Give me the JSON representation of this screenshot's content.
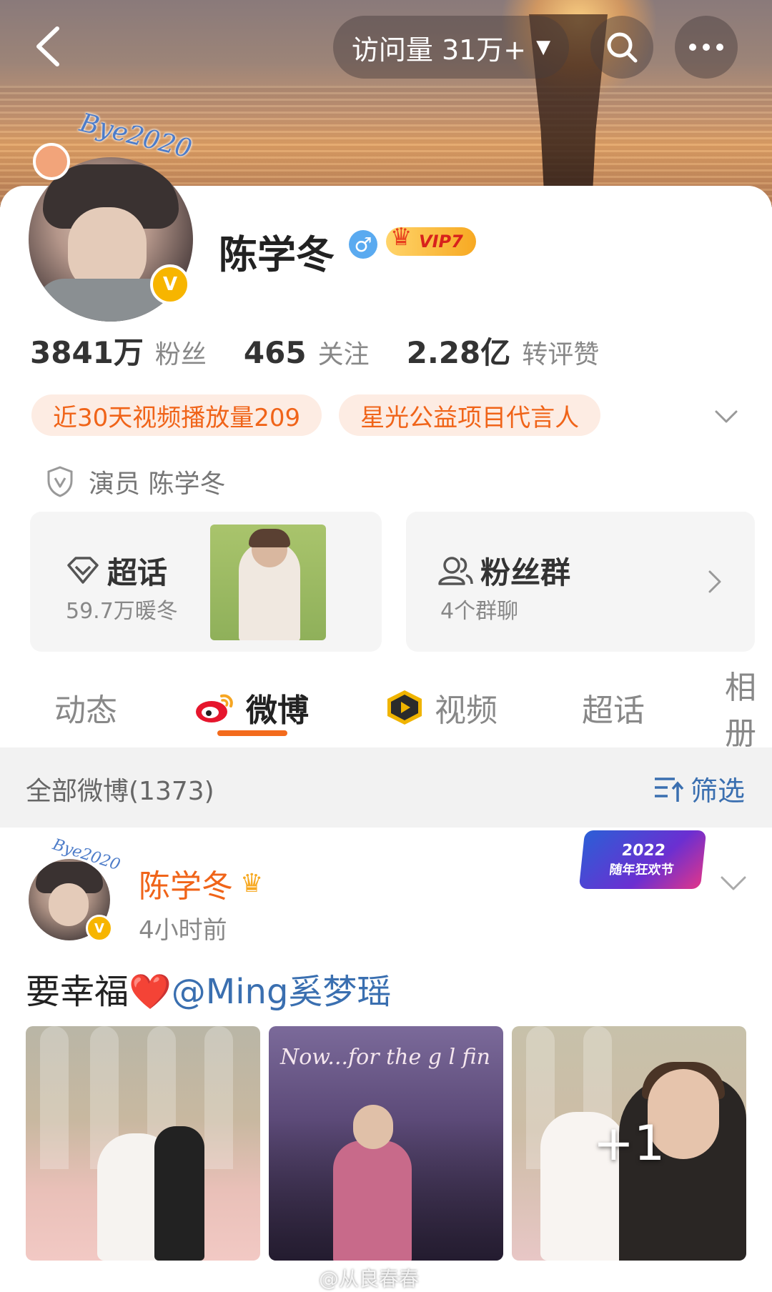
{
  "header": {
    "visit_label": "访问量 31万+"
  },
  "profile": {
    "name": "陈学冬",
    "avatar_frame_text": "Bye2020",
    "vip_label": "VIP7",
    "verified_badge": "V",
    "gender_symbol": "♂",
    "stats": [
      {
        "value": "3841万",
        "label": "粉丝"
      },
      {
        "value": "465",
        "label": "关注"
      },
      {
        "value": "2.28亿",
        "label": "转评赞"
      }
    ],
    "tags": [
      "近30天视频播放量209",
      "星光公益项目代言人"
    ],
    "verification": "演员 陈学冬"
  },
  "cards": {
    "super_topic": {
      "title": "超话",
      "subtitle": "59.7万暖冬"
    },
    "fan_group": {
      "title": "粉丝群",
      "subtitle": "4个群聊"
    }
  },
  "tabs": [
    "动态",
    "微博",
    "视频",
    "超话",
    "相册"
  ],
  "active_tab": "微博",
  "filter": {
    "count_label": "全部微博(1373)",
    "filter_label": "筛选"
  },
  "post": {
    "author": "陈学冬",
    "time": "4小时前",
    "text_prefix": "要幸福",
    "heart": "❤️",
    "mention": "@Ming奚梦瑶",
    "event_badge": {
      "year": "2022",
      "name": "随年狂欢节"
    },
    "photo2_script": "Now...for the g    l fin",
    "more_count": "+1"
  },
  "watermark": "@从良春春",
  "colors": {
    "accent": "#f36b1c",
    "tag_text": "#f06419",
    "tag_bg": "#fdece3",
    "link": "#3a6fb0",
    "verified": "#f7b500"
  }
}
